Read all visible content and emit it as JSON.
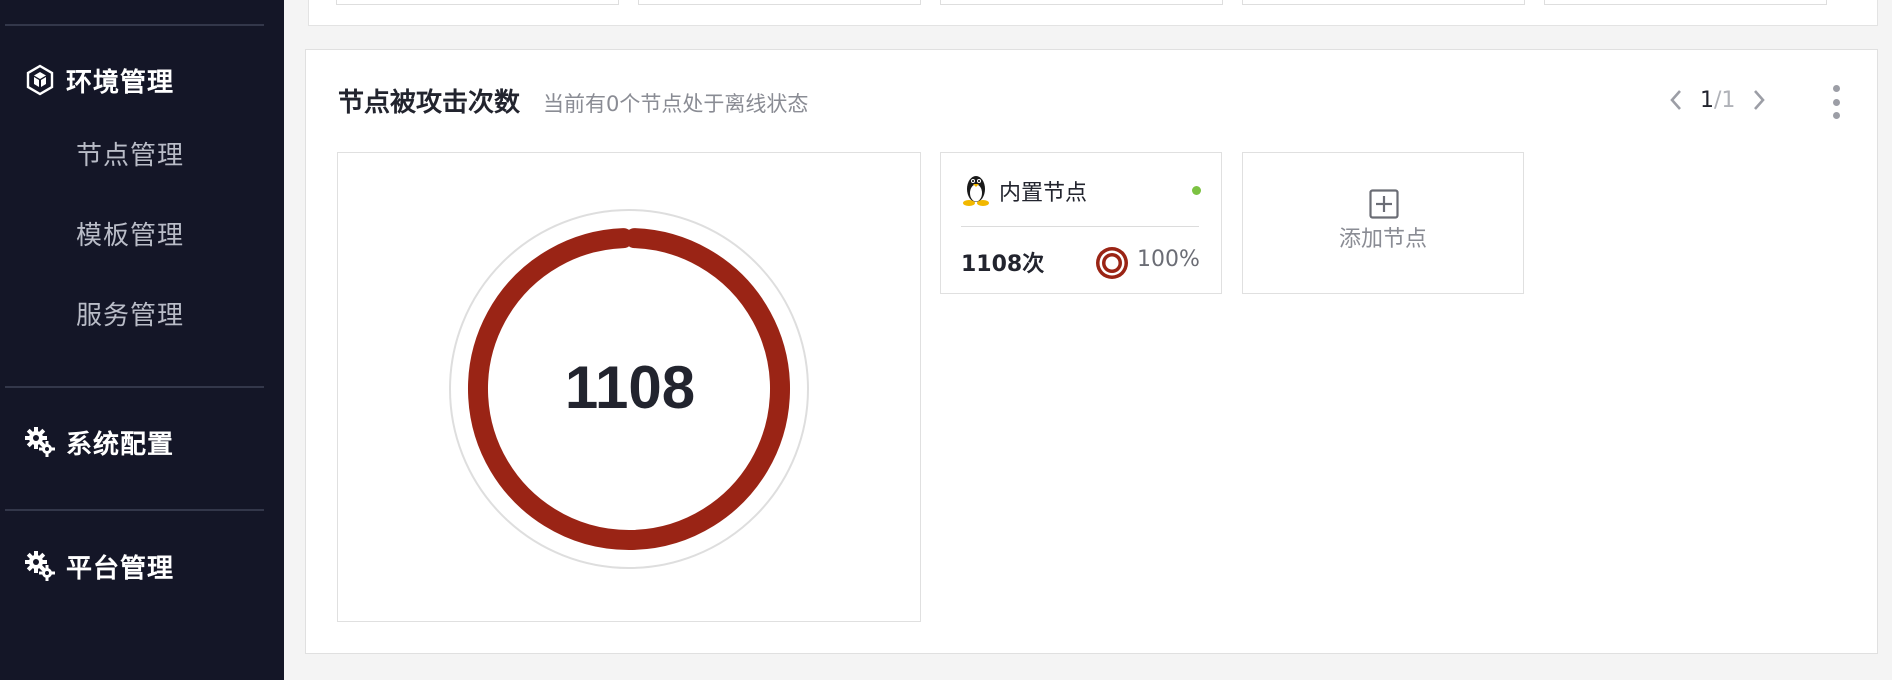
{
  "sidebar": {
    "groups": [
      {
        "label": "环境管理",
        "icon": "hexagon-cube-icon"
      },
      {
        "label": "系统配置",
        "icon": "gears-icon"
      },
      {
        "label": "平台管理",
        "icon": "gears-icon"
      }
    ],
    "sub_items": [
      {
        "label": "节点管理"
      },
      {
        "label": "模板管理"
      },
      {
        "label": "服务管理"
      }
    ]
  },
  "panel": {
    "title": "节点被攻击次数",
    "subtitle": "当前有0个节点处于离线状态",
    "pager": {
      "current": "1",
      "total": "/1"
    },
    "total_attacks": "1108",
    "nodes": [
      {
        "name": "内置节点",
        "count": "1108次",
        "percent": "100%",
        "status": "online",
        "os_icon": "linux-penguin-icon"
      }
    ],
    "add_node_label": "添加节点"
  },
  "colors": {
    "sidebar_bg": "#141627",
    "ring": "#9a2415",
    "online_dot": "#7cc242"
  }
}
